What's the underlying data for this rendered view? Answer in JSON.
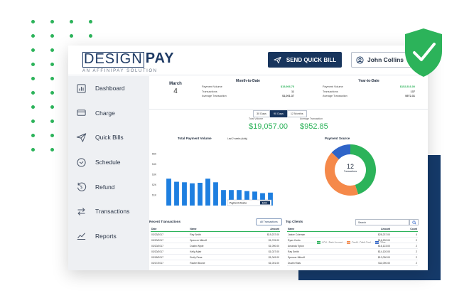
{
  "brand": {
    "logo_design": "DESIGN",
    "logo_pay": "PAY",
    "tagline": "AN AFFINIPAY SOLUTION",
    "accent": "#2cb35a",
    "navy": "#18355d"
  },
  "header": {
    "send_quick_bill": "SEND QUICK BILL",
    "user_name": "John Collins"
  },
  "sidebar": {
    "items": [
      {
        "label": "Dashboard",
        "icon": "bar-chart-icon"
      },
      {
        "label": "Charge",
        "icon": "credit-card-icon"
      },
      {
        "label": "Quick Bills",
        "icon": "paper-plane-icon"
      },
      {
        "label": "Schedule",
        "icon": "clock-icon"
      },
      {
        "label": "Refund",
        "icon": "refund-icon"
      },
      {
        "label": "Transactions",
        "icon": "transfer-arrows-icon"
      },
      {
        "label": "Reports",
        "icon": "line-chart-icon"
      }
    ]
  },
  "date": {
    "month": "March",
    "day": "4"
  },
  "month_to_date": {
    "title": "Month-to-Date",
    "rows": [
      {
        "label": "Payment Volume",
        "value": "$15,906.75"
      },
      {
        "label": "Transactions",
        "value": "11"
      },
      {
        "label": "Average Transaction",
        "value": "$1,001.37"
      }
    ]
  },
  "year_to_date": {
    "title": "Year-to-Date",
    "rows": [
      {
        "label": "Payment Volume",
        "value": "$152,516.00"
      },
      {
        "label": "Transactions",
        "value": "137"
      },
      {
        "label": "Average Transaction",
        "value": "$972.31"
      }
    ]
  },
  "range_toggle": [
    "30 Days",
    "90 Days",
    "12 Months"
  ],
  "totals": {
    "total_label": "Total Volume",
    "total_value": "$19,057.00",
    "avg_label": "Average Transaction",
    "avg_value": "$952.85"
  },
  "volume_chart": {
    "title": "Total Payment Volume",
    "subtitle": "Last 2 weeks (daily)",
    "tooltip_label": "Payment Volume",
    "tooltip_value": "$200",
    "y_ticks": [
      "$5K",
      "$4K",
      "$3K",
      "$2K",
      "$1K"
    ]
  },
  "chart_data": {
    "type": "bar",
    "title": "Total Payment Volume",
    "categories": [
      "1",
      "2",
      "3",
      "4",
      "5",
      "6",
      "7",
      "8",
      "9",
      "10",
      "11",
      "12",
      "13",
      "14"
    ],
    "values": [
      2600,
      2300,
      2250,
      2150,
      2200,
      2600,
      2250,
      1500,
      1500,
      1500,
      1400,
      1350,
      1200,
      1250
    ],
    "ylim": [
      0,
      5500
    ]
  },
  "payment_source": {
    "title": "Payment Source",
    "center_value": "12",
    "center_label": "Transactions",
    "slices": [
      {
        "name": "ACH - Bank",
        "value": 45,
        "color": "#2cb35a"
      },
      {
        "name": "Credit/Debit",
        "value": 42,
        "color": "#f5894a"
      },
      {
        "name": "Other",
        "value": 13,
        "color": "#2f64c8"
      }
    ],
    "legend": [
      "ACH - Bank Account",
      "Credit - Debit Card",
      "Other"
    ]
  },
  "recent_transactions": {
    "title": "Recent Transactions",
    "button": "All Transactions",
    "headers": [
      "Date",
      "Name",
      "Amount"
    ],
    "rows": [
      [
        "03/23/2017",
        "Ray Smith",
        "$19,237.00"
      ],
      [
        "03/20/2017",
        "Spencer Mitnoff",
        "$1,076.00"
      ],
      [
        "03/20/2017",
        "Dustin Wyde",
        "$1,090.00"
      ],
      [
        "03/20/2017",
        "Kelly Adair",
        "$1,027.00"
      ],
      [
        "03/18/2017",
        "Emily Pena",
        "$1,049.00"
      ],
      [
        "03/17/2017",
        "Rachel Boone",
        "$1,001.00"
      ]
    ]
  },
  "top_clients": {
    "title": "Top Clients",
    "search_placeholder": "Search",
    "headers": [
      "Name",
      "Amount",
      "Count"
    ],
    "rows": [
      [
        "Janice Coleman",
        "$28,237.00",
        "4"
      ],
      [
        "Ryan Curtis",
        "$16,292.00",
        "2"
      ],
      [
        "Amanda Tipton",
        "$16,123.00",
        "2"
      ],
      [
        "Ray Smith",
        "$14,120.00",
        "2"
      ],
      [
        "Spencer Mitnoff",
        "$12,090.00",
        "2"
      ],
      [
        "Dustin Rials",
        "$11,090.00",
        "2"
      ]
    ]
  }
}
